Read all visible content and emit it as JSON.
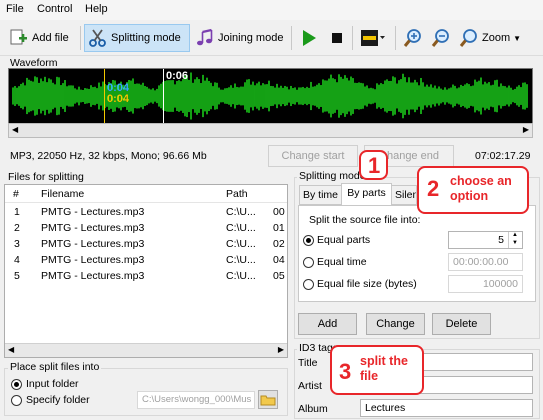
{
  "menu": {
    "file": "File",
    "control": "Control",
    "help": "Help"
  },
  "toolbar": {
    "add_file": "Add file",
    "splitting_mode": "Splitting mode",
    "joining_mode": "Joining mode",
    "zoom": "Zoom"
  },
  "waveform": {
    "label": "Waveform",
    "time_cursor": "0:06",
    "time_start_blue": "0:04",
    "time_start_yellow": "0:04"
  },
  "info": {
    "file_info": "MP3, 22050 Hz, 32 kbps, Mono; 96.66 Mb",
    "change_start": "Change start",
    "change_end": "Change end",
    "duration": "07:02:17.29"
  },
  "files_panel": {
    "label": "Files for splitting",
    "columns": [
      "#",
      "Filename",
      "Path",
      ""
    ],
    "rows": [
      {
        "num": "1",
        "filename": "PMTG - Lectures.mp3",
        "path": "C:\\U...",
        "extra": "00"
      },
      {
        "num": "2",
        "filename": "PMTG - Lectures.mp3",
        "path": "C:\\U...",
        "extra": "01"
      },
      {
        "num": "3",
        "filename": "PMTG - Lectures.mp3",
        "path": "C:\\U...",
        "extra": "02"
      },
      {
        "num": "4",
        "filename": "PMTG - Lectures.mp3",
        "path": "C:\\U...",
        "extra": "04"
      },
      {
        "num": "5",
        "filename": "PMTG - Lectures.mp3",
        "path": "C:\\U...",
        "extra": "05"
      }
    ]
  },
  "place_split": {
    "label": "Place split files into",
    "input_folder": "Input folder",
    "specify_folder": "Specify folder",
    "folder_path": "C:\\Users\\wongg_000\\Mus"
  },
  "splitting_mode": {
    "label": "Splitting mode",
    "tabs": [
      "By time",
      "By parts",
      "Silen"
    ],
    "split_into_label": "Split the source file into:",
    "equal_parts": "Equal parts",
    "equal_parts_value": "5",
    "equal_time": "Equal time",
    "equal_time_value": "00:00:00.00",
    "equal_size": "Equal file size (bytes)",
    "equal_size_value": "100000",
    "add": "Add",
    "change": "Change",
    "delete": "Delete"
  },
  "id3": {
    "label": "ID3 tags",
    "title_label": "Title",
    "artist_label": "Artist",
    "album_label": "Album",
    "title_value": "",
    "artist_value": "",
    "album_value": "Lectures"
  },
  "annotations": {
    "step1": "1",
    "step2": "2",
    "step2_text": "choose an option",
    "step3": "3",
    "step3_text": "split the file"
  },
  "colors": {
    "wave": "#1ee61e",
    "accent": "#e8262a",
    "selected_mode": "#cce4f7"
  }
}
